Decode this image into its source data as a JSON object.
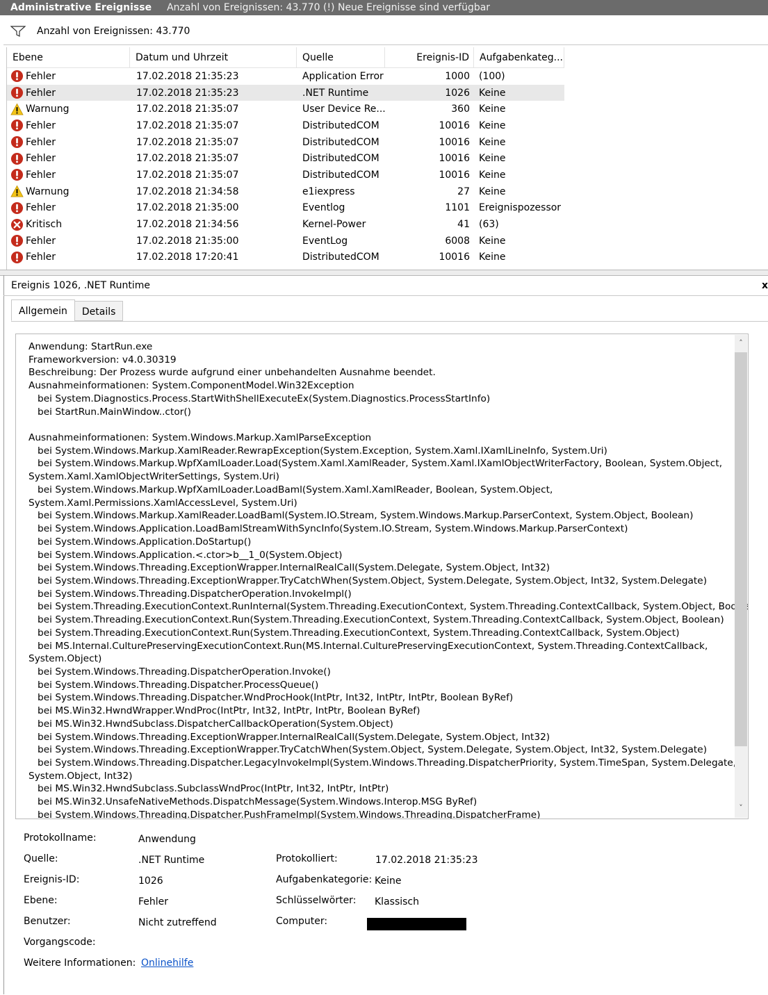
{
  "title": {
    "section": "Administrative Ereignisse",
    "status": "Anzahl von Ereignissen: 43.770 (!) Neue Ereignisse sind verfügbar"
  },
  "filter": {
    "label": "Anzahl von Ereignissen: 43.770",
    "icon": "filter-icon"
  },
  "columns": [
    "Ebene",
    "Datum und Uhrzeit",
    "Quelle",
    "Ereignis-ID",
    "Aufgabenkateg..."
  ],
  "events": [
    {
      "level": "Fehler",
      "icon": "error-icon",
      "date": "17.02.2018 21:35:23",
      "source": "Application Error",
      "id": "1000",
      "category": "(100)"
    },
    {
      "level": "Fehler",
      "icon": "error-icon",
      "date": "17.02.2018 21:35:23",
      "source": ".NET Runtime",
      "id": "1026",
      "category": "Keine",
      "selected": true
    },
    {
      "level": "Warnung",
      "icon": "warning-icon",
      "date": "17.02.2018 21:35:07",
      "source": "User Device Re...",
      "id": "360",
      "category": "Keine"
    },
    {
      "level": "Fehler",
      "icon": "error-icon",
      "date": "17.02.2018 21:35:07",
      "source": "DistributedCOM",
      "id": "10016",
      "category": "Keine"
    },
    {
      "level": "Fehler",
      "icon": "error-icon",
      "date": "17.02.2018 21:35:07",
      "source": "DistributedCOM",
      "id": "10016",
      "category": "Keine"
    },
    {
      "level": "Fehler",
      "icon": "error-icon",
      "date": "17.02.2018 21:35:07",
      "source": "DistributedCOM",
      "id": "10016",
      "category": "Keine"
    },
    {
      "level": "Fehler",
      "icon": "error-icon",
      "date": "17.02.2018 21:35:07",
      "source": "DistributedCOM",
      "id": "10016",
      "category": "Keine"
    },
    {
      "level": "Warnung",
      "icon": "warning-icon",
      "date": "17.02.2018 21:34:58",
      "source": "e1iexpress",
      "id": "27",
      "category": "Keine"
    },
    {
      "level": "Fehler",
      "icon": "error-icon",
      "date": "17.02.2018 21:35:00",
      "source": "Eventlog",
      "id": "1101",
      "category": "Ereignispozessor"
    },
    {
      "level": "Kritisch",
      "icon": "critical-icon",
      "date": "17.02.2018 21:34:56",
      "source": "Kernel-Power",
      "id": "41",
      "category": "(63)"
    },
    {
      "level": "Fehler",
      "icon": "error-icon",
      "date": "17.02.2018 21:35:00",
      "source": "EventLog",
      "id": "6008",
      "category": "Keine"
    },
    {
      "level": "Fehler",
      "icon": "error-icon",
      "date": "17.02.2018 17:20:41",
      "source": "DistributedCOM",
      "id": "10016",
      "category": "Keine"
    }
  ],
  "detail": {
    "header": "Ereignis 1026, .NET Runtime",
    "close": "x",
    "tabs": [
      "Allgemein",
      "Details"
    ],
    "message": "Anwendung: StartRun.exe\nFrameworkversion: v4.0.30319\nBeschreibung: Der Prozess wurde aufgrund einer unbehandelten Ausnahme beendet.\nAusnahmeinformationen: System.ComponentModel.Win32Exception\n   bei System.Diagnostics.Process.StartWithShellExecuteEx(System.Diagnostics.ProcessStartInfo)\n   bei StartRun.MainWindow..ctor()\n\nAusnahmeinformationen: System.Windows.Markup.XamlParseException\n   bei System.Windows.Markup.XamlReader.RewrapException(System.Exception, System.Xaml.IXamlLineInfo, System.Uri)\n   bei System.Windows.Markup.WpfXamlLoader.Load(System.Xaml.XamlReader, System.Xaml.IXamlObjectWriterFactory, Boolean, System.Object,\nSystem.Xaml.XamlObjectWriterSettings, System.Uri)\n   bei System.Windows.Markup.WpfXamlLoader.LoadBaml(System.Xaml.XamlReader, Boolean, System.Object,\nSystem.Xaml.Permissions.XamlAccessLevel, System.Uri)\n   bei System.Windows.Markup.XamlReader.LoadBaml(System.IO.Stream, System.Windows.Markup.ParserContext, System.Object, Boolean)\n   bei System.Windows.Application.LoadBamlStreamWithSyncInfo(System.IO.Stream, System.Windows.Markup.ParserContext)\n   bei System.Windows.Application.DoStartup()\n   bei System.Windows.Application.<.ctor>b__1_0(System.Object)\n   bei System.Windows.Threading.ExceptionWrapper.InternalRealCall(System.Delegate, System.Object, Int32)\n   bei System.Windows.Threading.ExceptionWrapper.TryCatchWhen(System.Object, System.Delegate, System.Object, Int32, System.Delegate)\n   bei System.Windows.Threading.DispatcherOperation.InvokeImpl()\n   bei System.Threading.ExecutionContext.RunInternal(System.Threading.ExecutionContext, System.Threading.ContextCallback, System.Object, Boolean)\n   bei System.Threading.ExecutionContext.Run(System.Threading.ExecutionContext, System.Threading.ContextCallback, System.Object, Boolean)\n   bei System.Threading.ExecutionContext.Run(System.Threading.ExecutionContext, System.Threading.ContextCallback, System.Object)\n   bei MS.Internal.CulturePreservingExecutionContext.Run(MS.Internal.CulturePreservingExecutionContext, System.Threading.ContextCallback,\nSystem.Object)\n   bei System.Windows.Threading.DispatcherOperation.Invoke()\n   bei System.Windows.Threading.Dispatcher.ProcessQueue()\n   bei System.Windows.Threading.Dispatcher.WndProcHook(IntPtr, Int32, IntPtr, IntPtr, Boolean ByRef)\n   bei MS.Win32.HwndWrapper.WndProc(IntPtr, Int32, IntPtr, IntPtr, Boolean ByRef)\n   bei MS.Win32.HwndSubclass.DispatcherCallbackOperation(System.Object)\n   bei System.Windows.Threading.ExceptionWrapper.InternalRealCall(System.Delegate, System.Object, Int32)\n   bei System.Windows.Threading.ExceptionWrapper.TryCatchWhen(System.Object, System.Delegate, System.Object, Int32, System.Delegate)\n   bei System.Windows.Threading.Dispatcher.LegacyInvokeImpl(System.Windows.Threading.DispatcherPriority, System.TimeSpan, System.Delegate,\nSystem.Object, Int32)\n   bei MS.Win32.HwndSubclass.SubclassWndProc(IntPtr, Int32, IntPtr, IntPtr)\n   bei MS.Win32.UnsafeNativeMethods.DispatchMessage(System.Windows.Interop.MSG ByRef)\n   bei System.Windows.Threading.Dispatcher.PushFrameImpl(System.Windows.Threading.DispatcherFrame)",
    "props": {
      "protokollname_label": "Protokollname:",
      "protokollname": "Anwendung",
      "quelle_label": "Quelle:",
      "quelle": ".NET Runtime",
      "protokolliert_label": "Protokolliert:",
      "protokolliert": "17.02.2018 21:35:23",
      "ereignis_id_label": "Ereignis-ID:",
      "ereignis_id": "1026",
      "aufgabenkategorie_label": "Aufgabenkategorie:",
      "aufgabenkategorie": "Keine",
      "ebene_label": "Ebene:",
      "ebene": "Fehler",
      "schluesselwoerter_label": "Schlüsselwörter:",
      "schluesselwoerter": "Klassisch",
      "benutzer_label": "Benutzer:",
      "benutzer": "Nicht zutreffend",
      "computer_label": "Computer:",
      "vorgangscode_label": "Vorgangscode:",
      "weitere_label": "Weitere Informationen:",
      "weitere_link": "Onlinehilfe"
    }
  },
  "colors": {
    "titlebar": "#6b6b6b",
    "error": "#c42b1c",
    "warning": "#f3c417",
    "selected_row": "#e8e8e8",
    "link": "#0a52c8"
  }
}
